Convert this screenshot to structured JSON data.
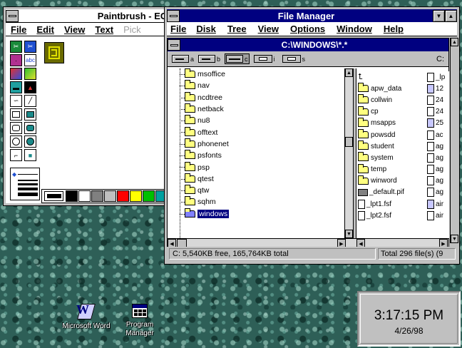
{
  "paintbrush": {
    "title": "Paintbrush - EG",
    "menu": [
      {
        "label": "File",
        "enabled": true
      },
      {
        "label": "Edit",
        "enabled": true
      },
      {
        "label": "View",
        "enabled": true
      },
      {
        "label": "Text",
        "enabled": true
      },
      {
        "label": "Pick",
        "enabled": false
      }
    ],
    "palette_colors": [
      "#000000",
      "#ffffff",
      "#808080",
      "#c0c0c0",
      "#ff0000",
      "#ffff00",
      "#00c000",
      "#00a0a0"
    ],
    "tool_icons": [
      "scissors-icon",
      "pick-icon",
      "airbrush-icon",
      "text-icon",
      "color-eraser-icon",
      "eraser-icon",
      "paint-roller-icon",
      "brush-icon",
      "curve-icon",
      "line-icon",
      "box-icon",
      "filled-box-icon",
      "rounded-box-icon",
      "filled-rounded-box-icon",
      "circle-icon",
      "filled-circle-icon",
      "polygon-icon",
      "filled-polygon-icon"
    ]
  },
  "file_manager": {
    "title": "File Manager",
    "menu": [
      "File",
      "Disk",
      "Tree",
      "View",
      "Options",
      "Window",
      "Help"
    ],
    "path_title": "C:\\WINDOWS\\*.*",
    "drives": [
      "a",
      "b",
      "c",
      "i",
      "s"
    ],
    "current_drive_label": "C:",
    "tree": [
      "msoffice",
      "nav",
      "ncdtree",
      "netback",
      "nu8",
      "offtext",
      "phonenet",
      "psfonts",
      "psp",
      "qtest",
      "qtw",
      "sqhm",
      "windows"
    ],
    "selected_tree_item": "windows",
    "files_col1": [
      {
        "name": "..",
        "kind": "up"
      },
      {
        "name": "apw_data",
        "kind": "folder"
      },
      {
        "name": "collwin",
        "kind": "folder"
      },
      {
        "name": "cp",
        "kind": "folder"
      },
      {
        "name": "msapps",
        "kind": "folder"
      },
      {
        "name": "powsdd",
        "kind": "folder"
      },
      {
        "name": "student",
        "kind": "folder"
      },
      {
        "name": "system",
        "kind": "folder"
      },
      {
        "name": "temp",
        "kind": "folder"
      },
      {
        "name": "winword",
        "kind": "folder"
      },
      {
        "name": "_default.pif",
        "kind": "pif"
      },
      {
        "name": "_lpt1.fsf",
        "kind": "doc"
      },
      {
        "name": "_lpt2.fsf",
        "kind": "doc"
      }
    ],
    "files_col2": [
      {
        "name": "_lp",
        "kind": "doc"
      },
      {
        "name": "12",
        "kind": "docblue"
      },
      {
        "name": "24",
        "kind": "doc"
      },
      {
        "name": "24",
        "kind": "doc"
      },
      {
        "name": "25",
        "kind": "docblue"
      },
      {
        "name": "ac",
        "kind": "doc"
      },
      {
        "name": "ag",
        "kind": "doc"
      },
      {
        "name": "ag",
        "kind": "doc"
      },
      {
        "name": "ag",
        "kind": "doc"
      },
      {
        "name": "ag",
        "kind": "doc"
      },
      {
        "name": "ag",
        "kind": "doc"
      },
      {
        "name": "air",
        "kind": "docblue"
      },
      {
        "name": "air",
        "kind": "doc"
      }
    ],
    "status_left": "C: 5,540KB free,  165,764KB total",
    "status_right": "Total 296 file(s) (9"
  },
  "desktop_icons": [
    {
      "label": "Microsoft Word",
      "icon": "word-icon"
    },
    {
      "label": "Program Manager",
      "icon": "program-manager-icon"
    }
  ],
  "clock": {
    "time": "3:17:15 PM",
    "date": "4/26/98"
  }
}
